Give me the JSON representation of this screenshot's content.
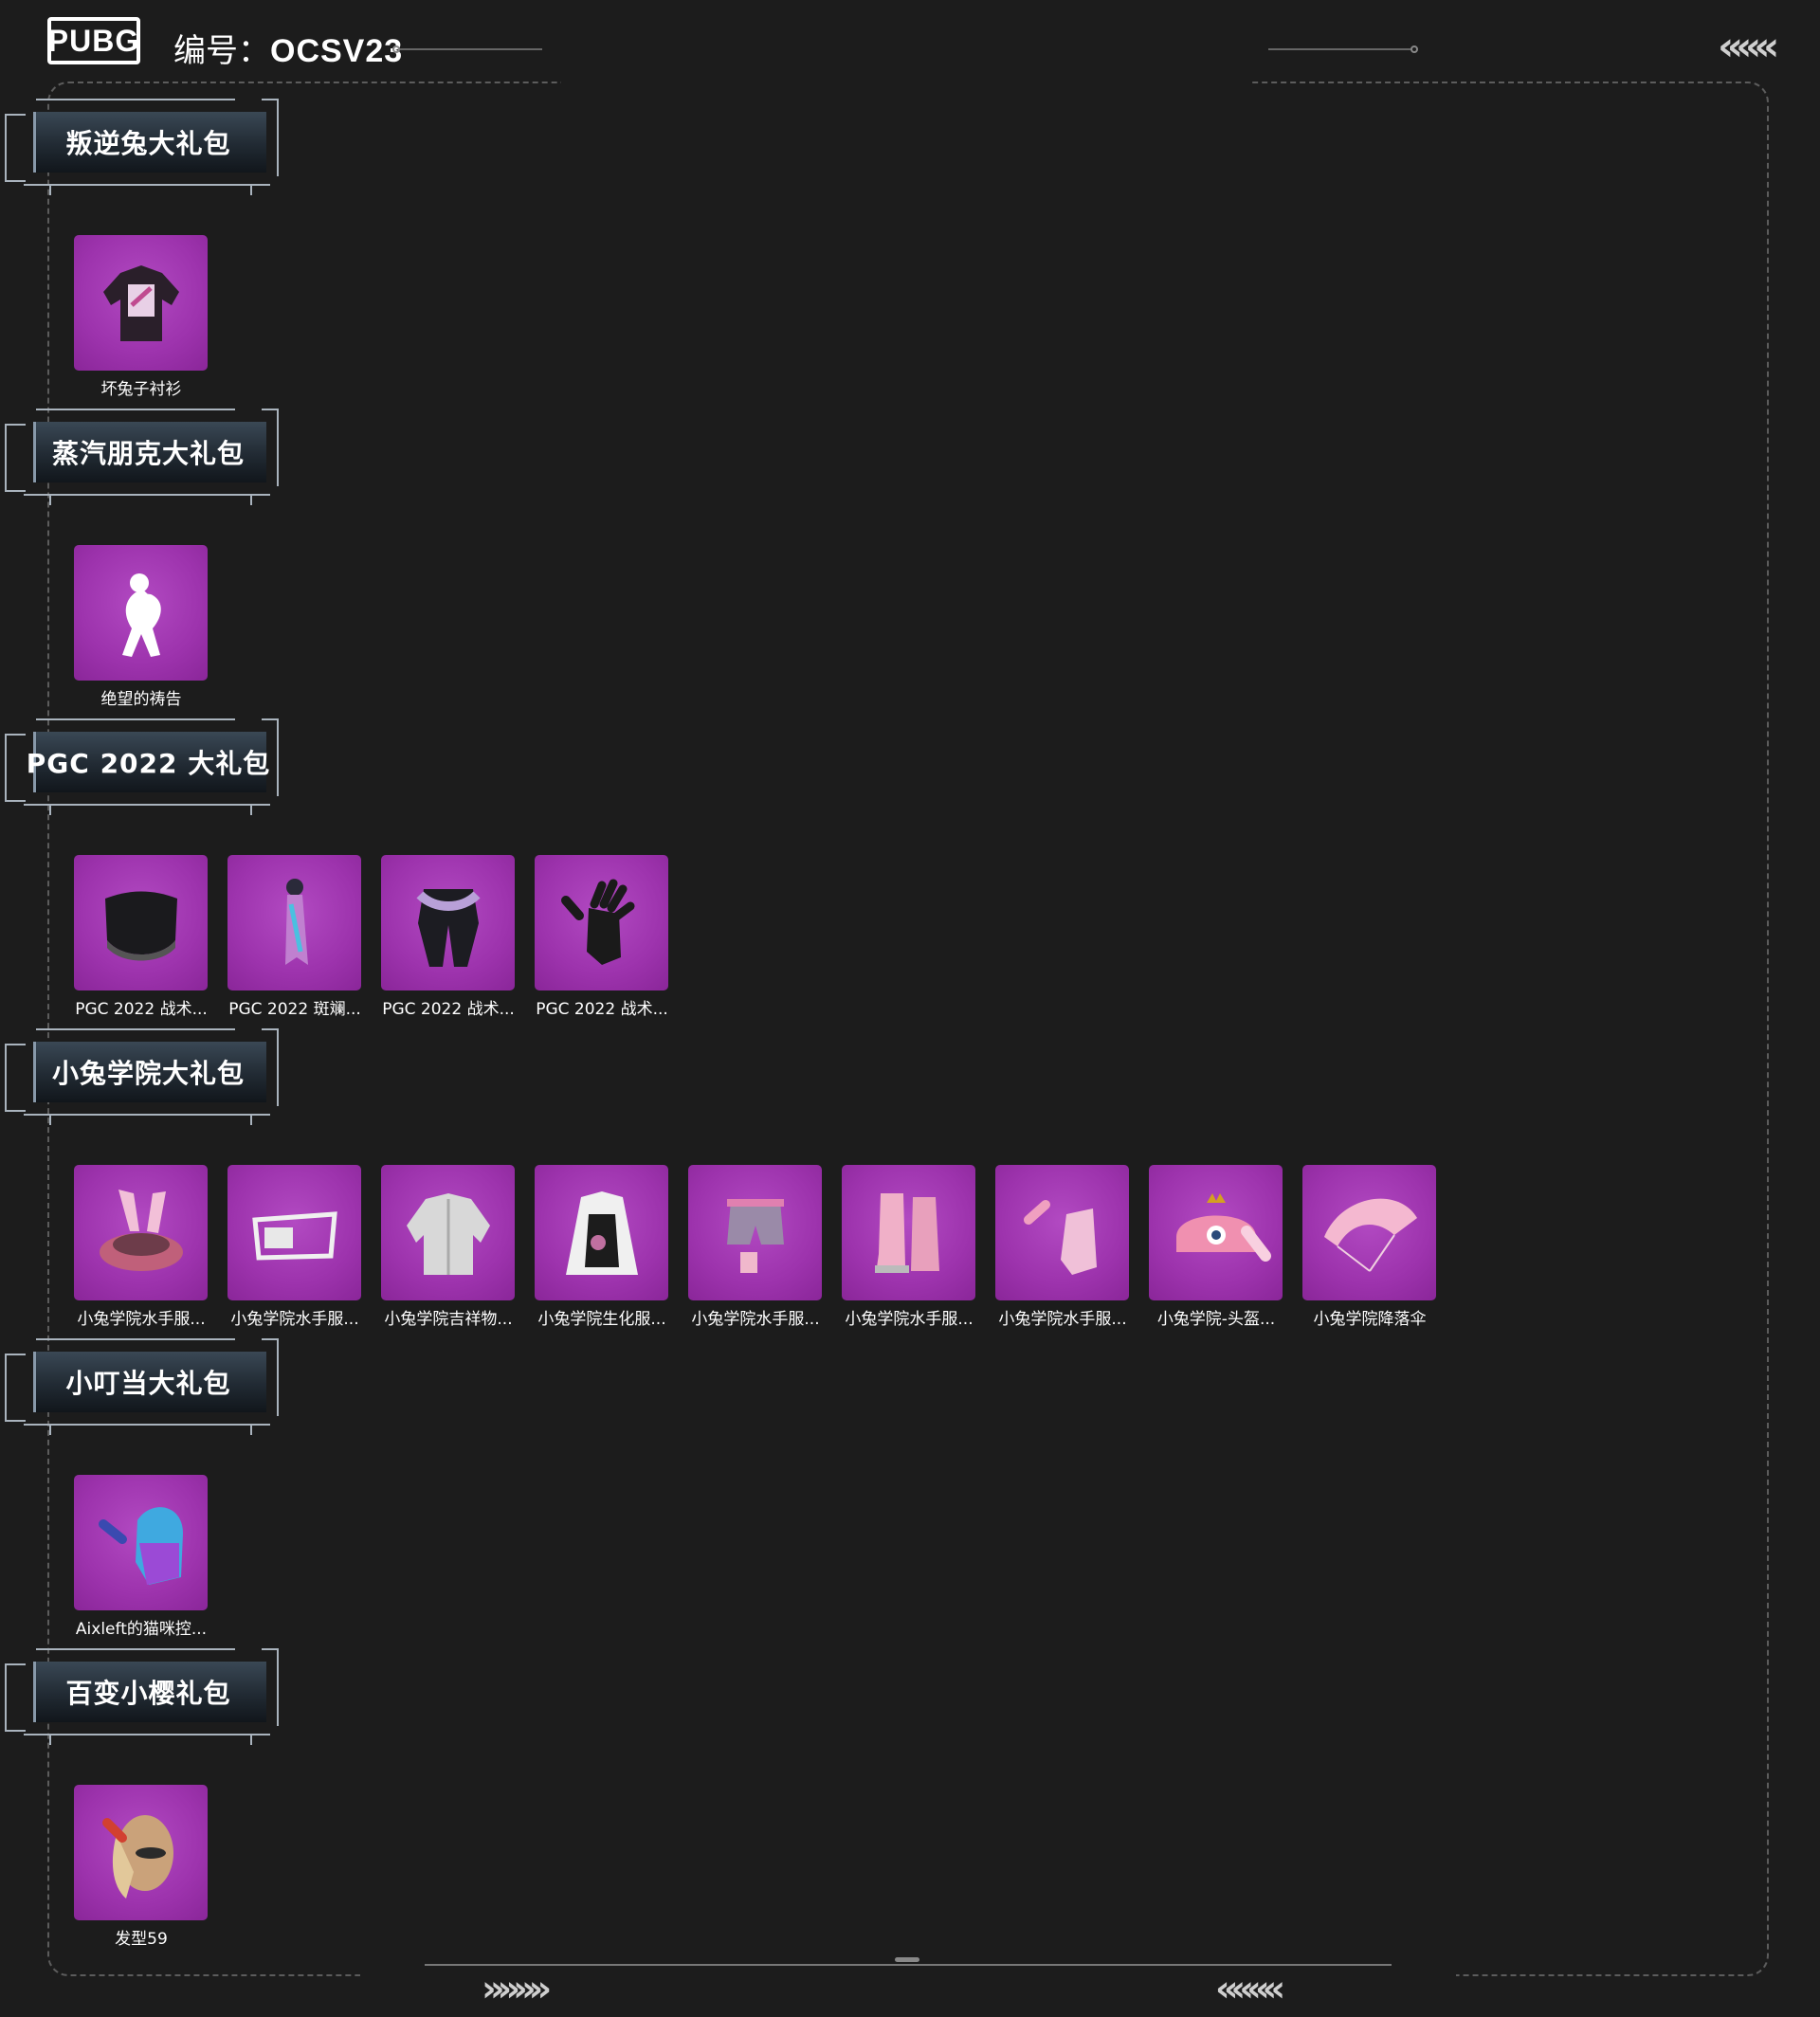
{
  "header": {
    "logo_text": "PUBG",
    "code_label": "编号：",
    "code_value": "OCSV23",
    "back_arrows": "«««"
  },
  "footer": {
    "left_arrows": "»»»»",
    "right_arrows": "««««"
  },
  "sections": [
    {
      "title": "叛逆兔大礼包",
      "items": [
        {
          "name": "坏兔子衬衫",
          "icon": "shirt-icon"
        }
      ]
    },
    {
      "title": "蒸汽朋克大礼包",
      "items": [
        {
          "name": "绝望的祷告",
          "icon": "emote-pose-icon"
        }
      ]
    },
    {
      "title": "PGC 2022 大礼包",
      "items": [
        {
          "name": "PGC 2022 战术...",
          "icon": "mask-icon"
        },
        {
          "name": "PGC 2022 斑斓...",
          "icon": "scarf-icon"
        },
        {
          "name": "PGC 2022 战术...",
          "icon": "pants-icon"
        },
        {
          "name": "PGC 2022 战术...",
          "icon": "gloves-icon"
        }
      ]
    },
    {
      "title": "小兔学院大礼包",
      "items": [
        {
          "name": "小兔学院水手服...",
          "icon": "bunny-goggles-icon"
        },
        {
          "name": "小兔学院水手服...",
          "icon": "glasses-icon"
        },
        {
          "name": "小兔学院吉祥物...",
          "icon": "jacket-icon"
        },
        {
          "name": "小兔学院生化服...",
          "icon": "vest-icon"
        },
        {
          "name": "小兔学院水手服...",
          "icon": "shorts-icon"
        },
        {
          "name": "小兔学院水手服...",
          "icon": "boots-icon"
        },
        {
          "name": "小兔学院水手服...",
          "icon": "gloves-pink-icon"
        },
        {
          "name": "小兔学院-头盔...",
          "icon": "bunny-helmet-icon"
        },
        {
          "name": "小兔学院降落伞",
          "icon": "parachute-icon"
        }
      ]
    },
    {
      "title": "小叮当大礼包",
      "items": [
        {
          "name": "Aixleft的猫咪控...",
          "icon": "cat-gloves-icon"
        }
      ]
    },
    {
      "title": "百变小樱礼包",
      "items": [
        {
          "name": "发型59",
          "icon": "hairstyle-icon"
        }
      ]
    }
  ],
  "colors": {
    "background": "#1c1c1c",
    "tile": "#9d33ad",
    "banner": "#2a3540"
  }
}
